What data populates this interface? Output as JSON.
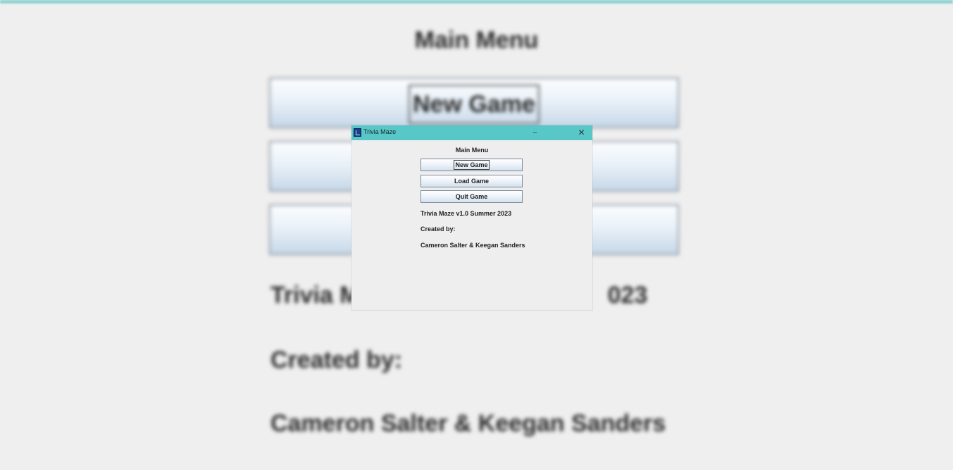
{
  "window": {
    "title": "Trivia Maze",
    "controls": {
      "minimize": "–",
      "maximize": "□",
      "close": "✕"
    },
    "icon": "app-icon"
  },
  "menu": {
    "title": "Main Menu",
    "buttons": {
      "new_game": "New Game",
      "load_game": "Load Game",
      "quit_game": "Quit Game"
    },
    "focused": "new_game"
  },
  "info": {
    "version": "Trivia Maze v1.0 Summer 2023",
    "created_by": "Created by:",
    "authors": "Cameron Salter & Keegan Sanders"
  },
  "background": {
    "title": "Main Menu",
    "button_new": "New Game",
    "version_partial": "Trivia M",
    "version_tail": "023",
    "created_by": "Created by:",
    "authors": "Cameron Salter & Keegan Sanders"
  },
  "colors": {
    "titlebar": "#57c7c8",
    "top_accent": "#8fd3d1",
    "background": "#efefef"
  }
}
